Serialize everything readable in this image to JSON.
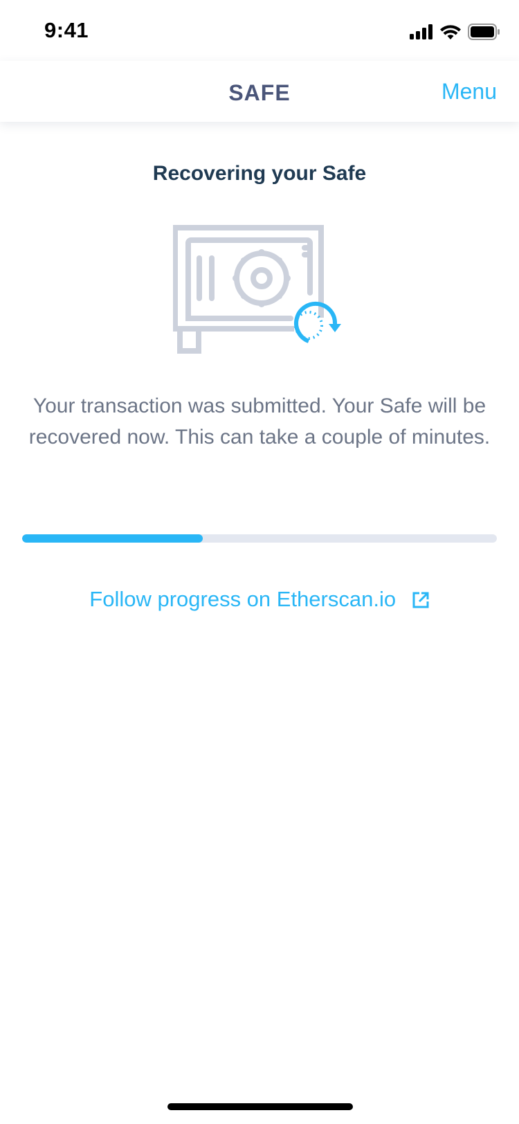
{
  "status_bar": {
    "time": "9:41",
    "icons": [
      "signal-icon",
      "wifi-icon",
      "battery-icon"
    ]
  },
  "nav": {
    "title": "SAFE",
    "menu_label": "Menu"
  },
  "main": {
    "heading": "Recovering your Safe",
    "illustration": "safe-recovery-icon",
    "description": "Your transaction was submitted. Your Safe will be recovered now. This can take a couple of minutes.",
    "progress": 0.38,
    "link_label": "Follow progress on Etherscan.io",
    "link_icon": "external-link-icon"
  },
  "colors": {
    "accent": "#29b6f6",
    "title": "#4a5579",
    "heading": "#1f3a52",
    "text": "#6b7486",
    "track": "#e3e7f0",
    "icon_gray": "#ccd1dc"
  }
}
